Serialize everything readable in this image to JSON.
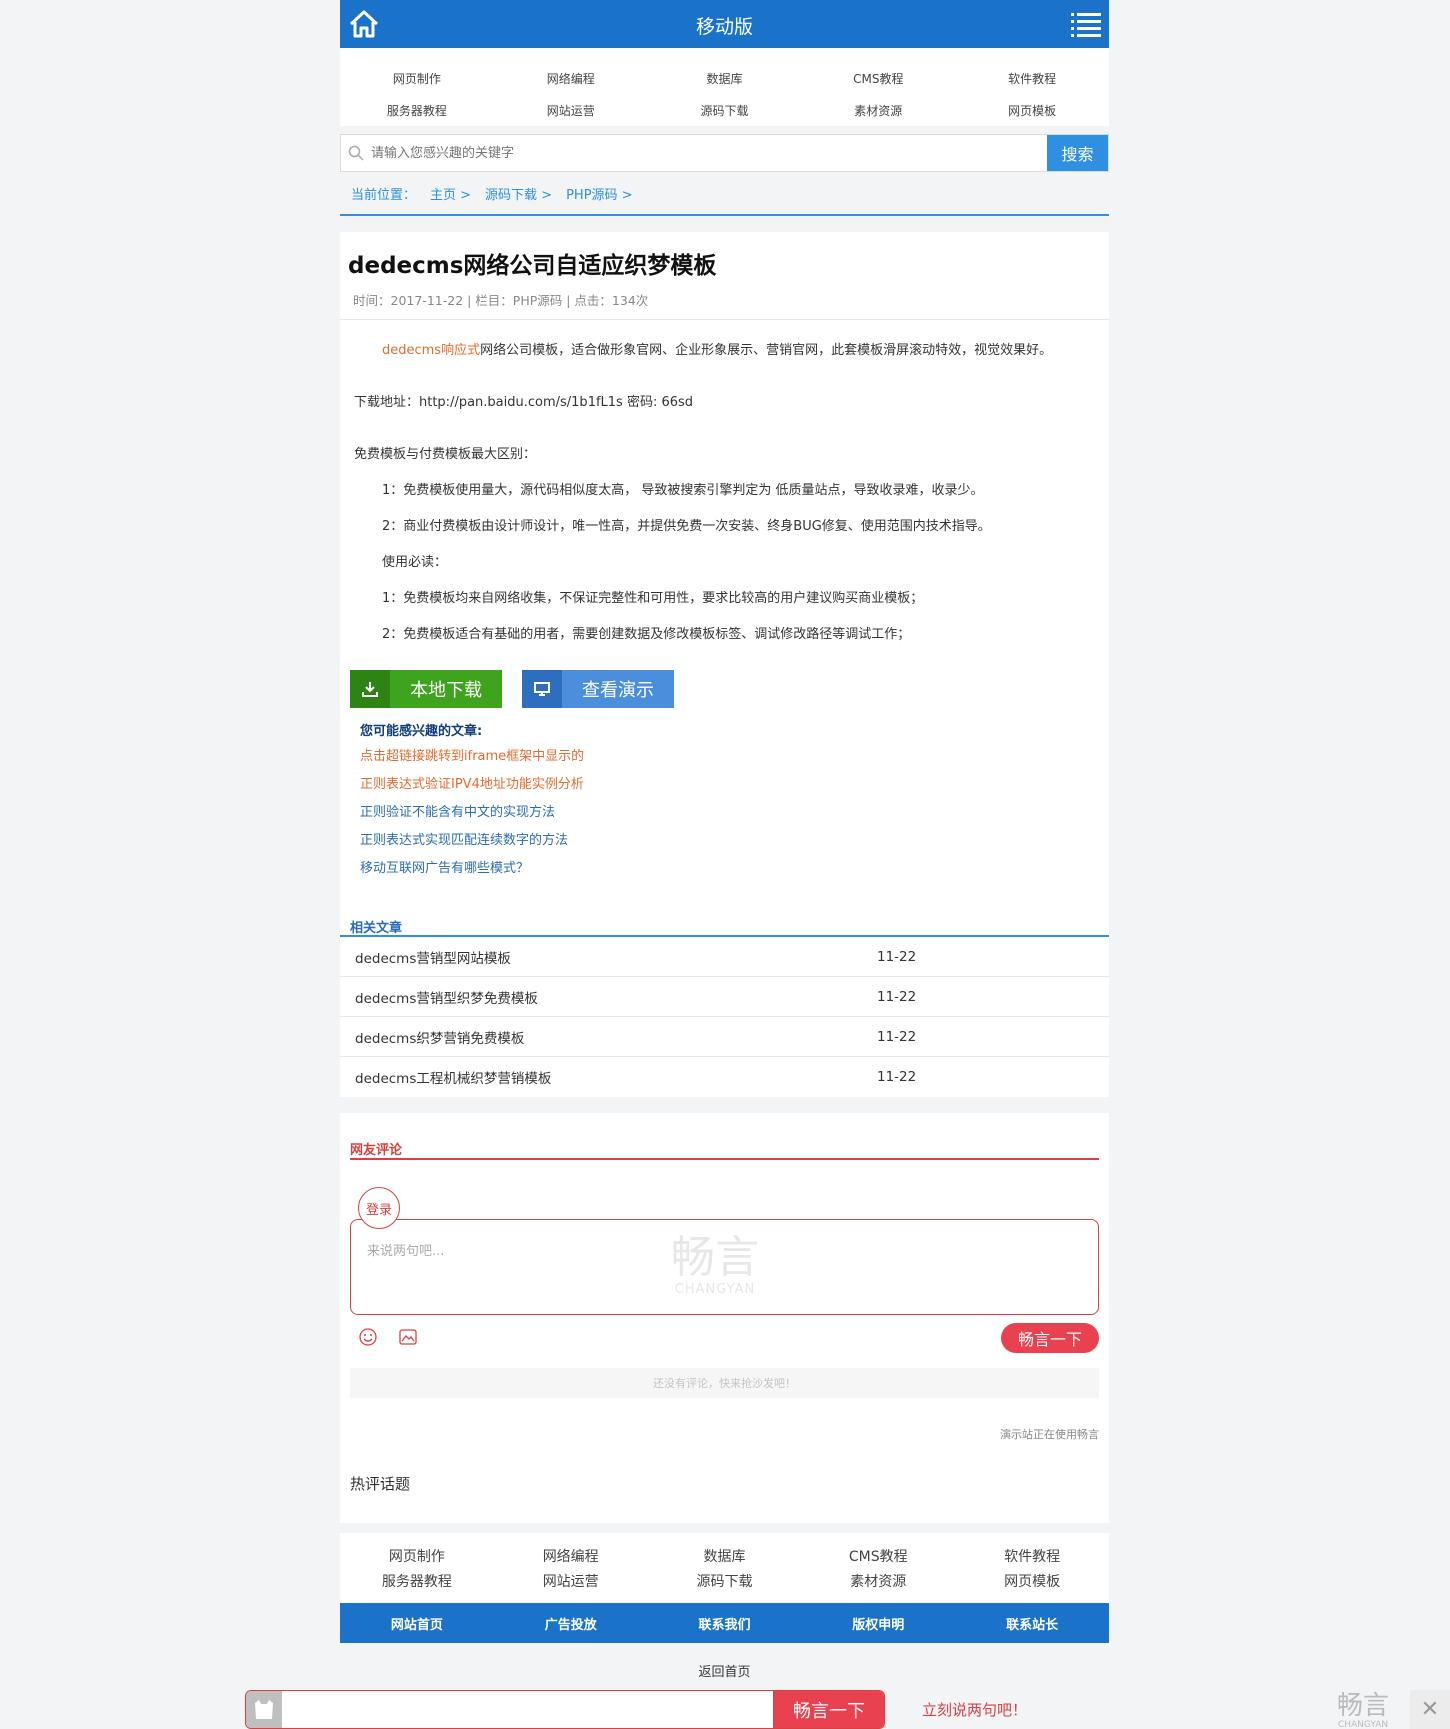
{
  "header": {
    "title": "移动版",
    "home_icon": "home-icon",
    "menu_icon": "menu-icon"
  },
  "nav": {
    "row1": [
      "网页制作",
      "网络编程",
      "数据库",
      "CMS教程",
      "软件教程"
    ],
    "row2": [
      "服务器教程",
      "网站运营",
      "源码下载",
      "素材资源",
      "网页模板"
    ]
  },
  "search": {
    "placeholder": "请输入您感兴趣的关键字",
    "button": "搜索"
  },
  "breadcrumb": {
    "label": "当前位置：",
    "items": [
      "主页 >",
      "源码下载 >",
      "PHP源码 >"
    ]
  },
  "article": {
    "title": "dedecms网络公司自适应织梦模板",
    "meta": "时间：2017-11-22 | 栏目：PHP源码 | 点击：134次",
    "intro_link": "dedecms响应式",
    "intro_rest": "网络公司模板，适合做形象官网、企业形象展示、营销官网，此套模板滑屏滚动特效，视觉效果好。",
    "download": "下载地址：http://pan.baidu.com/s/1b1fL1s 密码: 66sd",
    "diff_title": "免费模板与付费模板最大区别：",
    "diff1": "1：免费模板使用量大，源代码相似度太高， 导致被搜索引擎判定为 低质量站点，导致收录难，收录少。",
    "diff2": "2：商业付费模板由设计师设计，唯一性高，并提供免费一次安装、终身BUG修复、使用范围内技术指导。",
    "must_title": "使用必读：",
    "must1": "1：免费模板均来自网络收集，不保证完整性和可用性，要求比较高的用户建议购买商业模板；",
    "must2": "2：免费模板适合有基础的用者，需要创建数据及修改模板标签、调试修改路径等调试工作；",
    "btn_download": "本地下载",
    "btn_demo": "查看演示"
  },
  "interest": {
    "title": "您可能感兴趣的文章:",
    "links": [
      "点击超链接跳转到iframe框架中显示的",
      "正则表达式验证IPV4地址功能实例分析",
      "正则验证不能含有中文的实现方法",
      "正则表达式实现匹配连续数字的方法",
      "移动互联网广告有哪些模式？"
    ]
  },
  "related": {
    "title": "相关文章",
    "rows": [
      {
        "title": "dedecms营销型网站模板",
        "date": "11-22"
      },
      {
        "title": "dedecms营销型织梦免费模板",
        "date": "11-22"
      },
      {
        "title": "dedecms织梦营销免费模板",
        "date": "11-22"
      },
      {
        "title": "dedecms工程机械织梦营销模板",
        "date": "11-22"
      }
    ]
  },
  "comment": {
    "title": "网友评论",
    "login": "登录",
    "placeholder": "来说两句吧...",
    "watermark_cn": "畅言",
    "watermark_en": "CHANGYAN",
    "send": "畅言一下",
    "empty": "还没有评论，快来抢沙发吧！",
    "using": "演示站正在使用畅言",
    "hot": "热评话题"
  },
  "footer": {
    "row1": [
      "网页制作",
      "网络编程",
      "数据库",
      "CMS教程",
      "软件教程"
    ],
    "row2": [
      "服务器教程",
      "网站运营",
      "源码下载",
      "素材资源",
      "网页模板"
    ],
    "bar": [
      "网站首页",
      "广告投放",
      "联系我们",
      "版权申明",
      "联系站长"
    ],
    "back_home": "返回首页"
  },
  "bottom": {
    "send": "畅言一下",
    "say": "立刻说两句吧！",
    "brand_cn": "畅言",
    "brand_en": "CHANGYAN",
    "close": "✕"
  },
  "colors": {
    "primary": "#1a73c9",
    "accent": "#2f8fe0",
    "red": "#e94150",
    "orange": "#e56b2d",
    "green": "#3ea41d"
  }
}
